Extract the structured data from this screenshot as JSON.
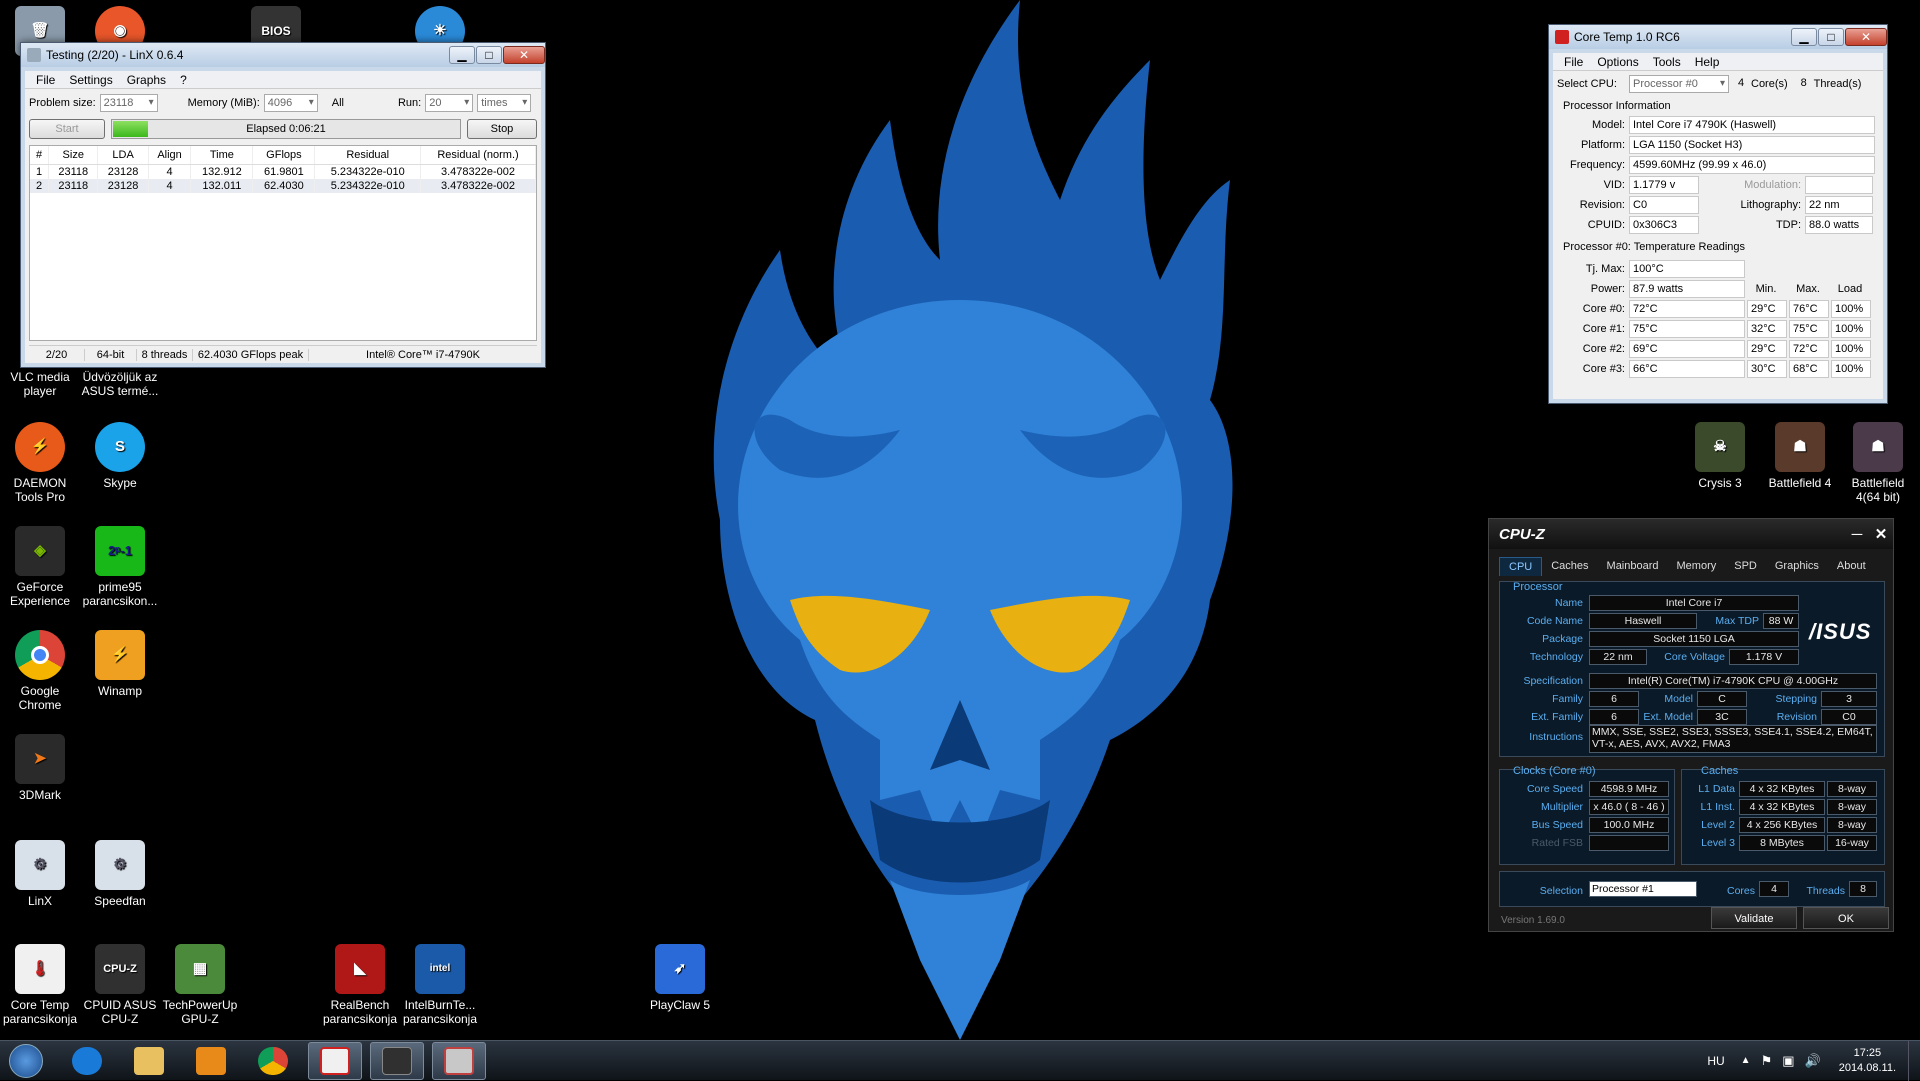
{
  "linx": {
    "title": "Testing (2/20) - LinX 0.6.4",
    "menu": [
      "File",
      "Settings",
      "Graphs",
      "?"
    ],
    "problem_size_label": "Problem size:",
    "problem_size": "23118",
    "memory_label": "Memory (MiB):",
    "memory": "4096",
    "all_label": "All",
    "run_label": "Run:",
    "run": "20",
    "run_unit": "times",
    "start_label": "Start",
    "elapsed": "Elapsed 0:06:21",
    "stop_label": "Stop",
    "columns": [
      "#",
      "Size",
      "LDA",
      "Align",
      "Time",
      "GFlops",
      "Residual",
      "Residual (norm.)"
    ],
    "rows": [
      [
        "1",
        "23118",
        "23128",
        "4",
        "132.912",
        "61.9801",
        "5.234322e-010",
        "3.478322e-002"
      ],
      [
        "2",
        "23118",
        "23128",
        "4",
        "132.011",
        "62.4030",
        "5.234322e-010",
        "3.478322e-002"
      ]
    ],
    "status": [
      "2/20",
      "64-bit",
      "8 threads",
      "62.4030 GFlops peak",
      "Intel® Core™ i7-4790K"
    ]
  },
  "coretemp": {
    "title": "Core Temp 1.0 RC6",
    "menu": [
      "File",
      "Options",
      "Tools",
      "Help"
    ],
    "select_cpu_label": "Select CPU:",
    "processor_select": "Processor #0",
    "cores": "4",
    "cores_label": "Core(s)",
    "threads": "8",
    "threads_label": "Thread(s)",
    "info_header": "Processor Information",
    "model_label": "Model:",
    "model": "Intel Core i7 4790K (Haswell)",
    "platform_label": "Platform:",
    "platform": "LGA 1150 (Socket H3)",
    "frequency_label": "Frequency:",
    "frequency": "4599.60MHz (99.99 x 46.0)",
    "vid_label": "VID:",
    "vid": "1.1779 v",
    "modulation_label": "Modulation:",
    "revision_label": "Revision:",
    "revision": "C0",
    "lithography_label": "Lithography:",
    "lithography": "22 nm",
    "cpuid_label": "CPUID:",
    "cpuid": "0x306C3",
    "tdp_label": "TDP:",
    "tdp": "88.0 watts",
    "temp_header": "Processor #0: Temperature Readings",
    "tjmax_label": "Tj. Max:",
    "tjmax": "100°C",
    "power_label": "Power:",
    "power": "87.9 watts",
    "min_label": "Min.",
    "max_label": "Max.",
    "load_label": "Load",
    "cores_list": [
      {
        "label": "Core #0:",
        "temp": "72°C",
        "min": "29°C",
        "max": "76°C",
        "load": "100%"
      },
      {
        "label": "Core #1:",
        "temp": "75°C",
        "min": "32°C",
        "max": "75°C",
        "load": "100%"
      },
      {
        "label": "Core #2:",
        "temp": "69°C",
        "min": "29°C",
        "max": "72°C",
        "load": "100%"
      },
      {
        "label": "Core #3:",
        "temp": "66°C",
        "min": "30°C",
        "max": "68°C",
        "load": "100%"
      }
    ]
  },
  "cpuz": {
    "title": "CPU-Z",
    "tabs": [
      "CPU",
      "Caches",
      "Mainboard",
      "Memory",
      "SPD",
      "Graphics",
      "About"
    ],
    "processor_group": "Processor",
    "name_label": "Name",
    "name": "Intel Core i7",
    "codename_label": "Code Name",
    "codename": "Haswell",
    "maxtdp_label": "Max TDP",
    "maxtdp": "88 W",
    "package_label": "Package",
    "package": "Socket 1150 LGA",
    "technology_label": "Technology",
    "technology": "22 nm",
    "corevoltage_label": "Core Voltage",
    "corevoltage": "1.178 V",
    "brand_logo": "/ISUS",
    "spec_label": "Specification",
    "spec": "Intel(R) Core(TM) i7-4790K CPU @ 4.00GHz",
    "family_label": "Family",
    "family": "6",
    "model_label": "Model",
    "model": "C",
    "stepping_label": "Stepping",
    "stepping": "3",
    "extfamily_label": "Ext. Family",
    "extfamily": "6",
    "extmodel_label": "Ext. Model",
    "extmodel": "3C",
    "revision_label": "Revision",
    "revision": "C0",
    "instructions_label": "Instructions",
    "instructions": "MMX, SSE, SSE2, SSE3, SSSE3, SSE4.1, SSE4.2, EM64T, VT-x, AES, AVX, AVX2, FMA3",
    "clocks_group": "Clocks (Core #0)",
    "corespeed_label": "Core Speed",
    "corespeed": "4598.9 MHz",
    "multiplier_label": "Multiplier",
    "multiplier": "x 46.0 ( 8 - 46 )",
    "busspeed_label": "Bus Speed",
    "busspeed": "100.0 MHz",
    "ratedfsb_label": "Rated FSB",
    "caches_group": "Caches",
    "l1d_label": "L1 Data",
    "l1d": "4 x 32 KBytes",
    "l1d_way": "8-way",
    "l1i_label": "L1 Inst.",
    "l1i": "4 x 32 KBytes",
    "l1i_way": "8-way",
    "l2_label": "Level 2",
    "l2": "4 x 256 KBytes",
    "l2_way": "8-way",
    "l3_label": "Level 3",
    "l3": "8 MBytes",
    "l3_way": "16-way",
    "selection_label": "Selection",
    "selection": "Processor #1",
    "cores_label": "Cores",
    "cores": "4",
    "threads_label": "Threads",
    "threads": "8",
    "version": "Version 1.69.0",
    "validate_label": "Validate",
    "ok_label": "OK"
  },
  "desktop_icons": {
    "vlc": "VLC media player",
    "asus_welcome": "Üdvözöljük az ASUS termé...",
    "daemon": "DAEMON Tools Pro",
    "skype": "Skype",
    "geforce": "GeForce Experience",
    "prime95": "prime95 parancsikon...",
    "chrome": "Google Chrome",
    "winamp": "Winamp",
    "threedmark": "3DMark",
    "linx": "LinX",
    "speedfan": "Speedfan",
    "coretemp": "Core Temp parancsikonja",
    "cpuid": "CPUID ASUS CPU-Z",
    "techpowerup": "TechPowerUp GPU-Z",
    "realbench": "RealBench parancsikonja",
    "intelburn": "IntelBurnTe... parancsikonja",
    "playclaw": "PlayClaw 5",
    "crysis": "Crysis 3",
    "bf4": "Battlefield 4",
    "bf4_64": "Battlefield 4(64 bit)",
    "bios_glyph": "BIOS"
  },
  "taskbar": {
    "language": "HU",
    "time": "17:25",
    "date": "2014.08.11."
  },
  "colors": {
    "skull_blue": "#1f6fc4",
    "skull_light": "#3d8ee0",
    "skull_dark": "#0b3a78",
    "cpuz_label": "#5aaef0"
  }
}
